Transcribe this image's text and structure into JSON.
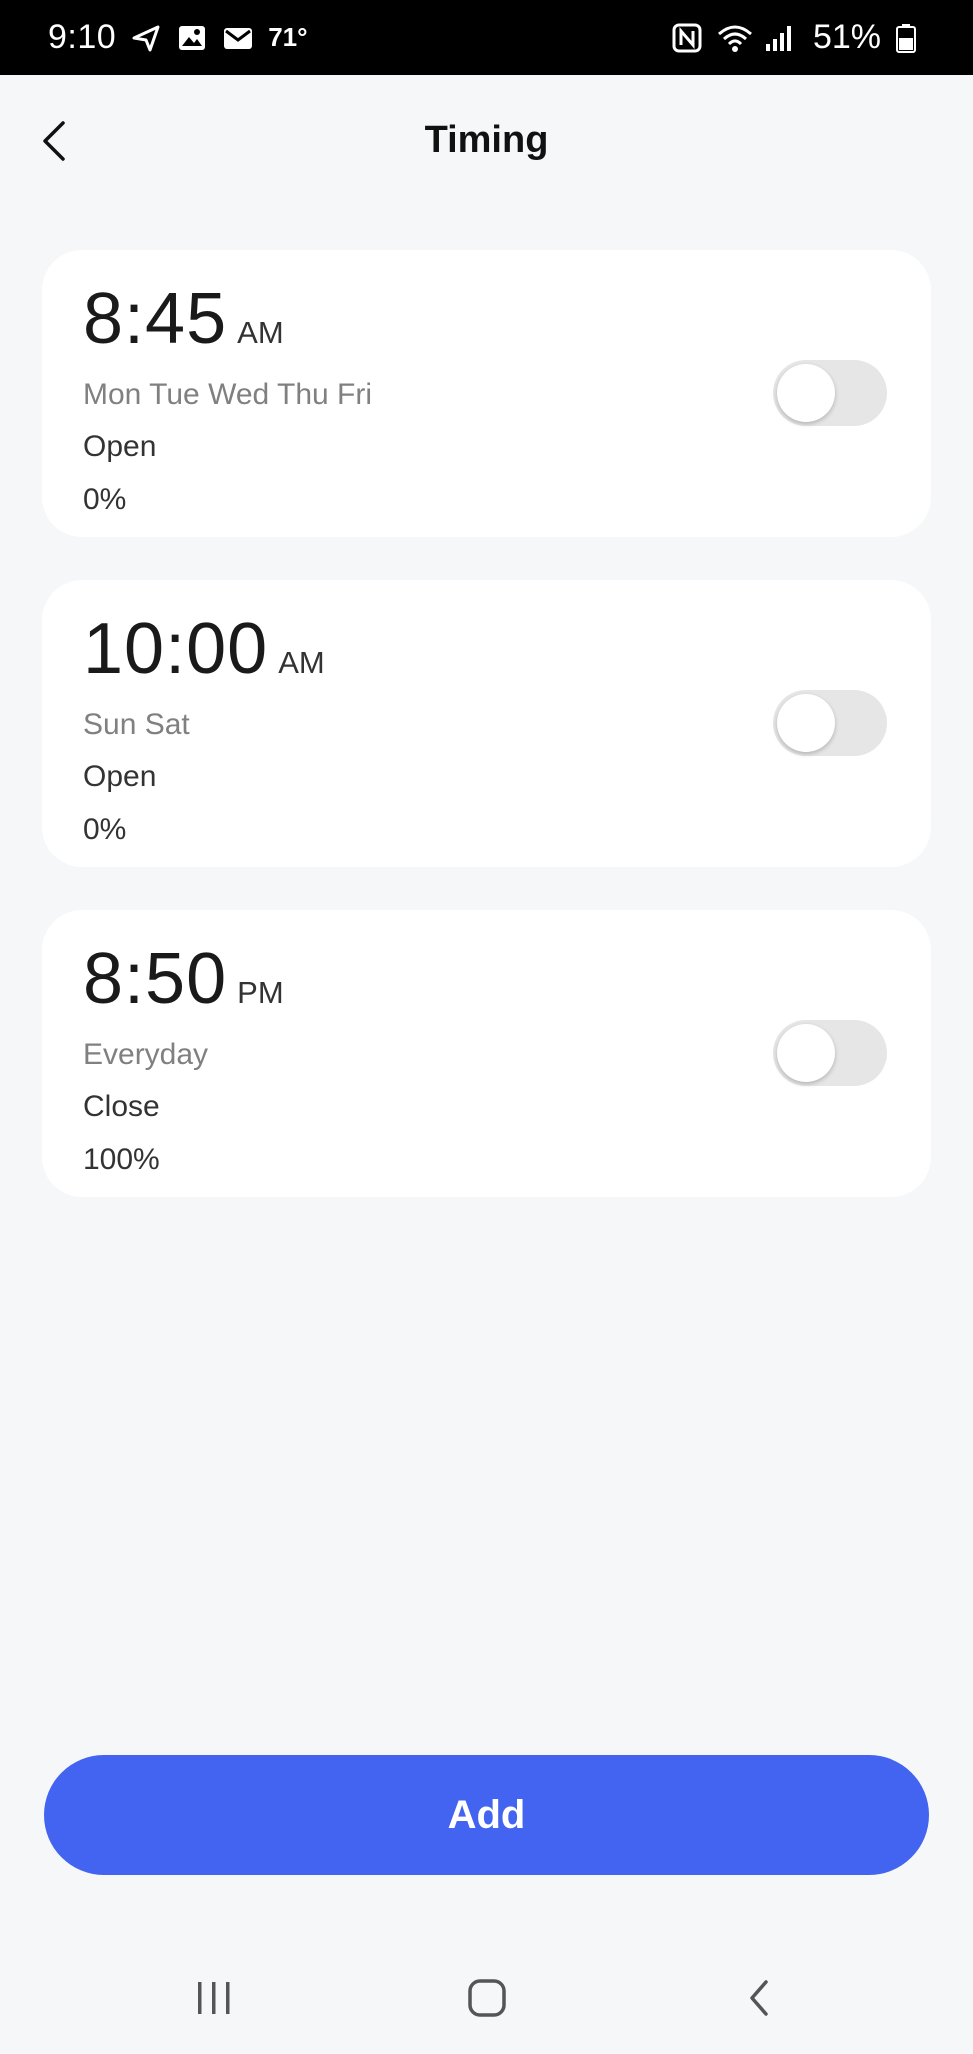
{
  "status_bar": {
    "time": "9:10",
    "temperature": "71°",
    "battery": "51%",
    "icons_left": [
      "navigation-arrow-icon",
      "image-icon",
      "mail-icon"
    ],
    "icons_right": [
      "nfc-icon",
      "wifi-icon",
      "signal-icon",
      "battery-icon"
    ]
  },
  "header": {
    "title": "Timing",
    "back_icon": "chevron-left-icon"
  },
  "timers": [
    {
      "time": "8:45",
      "period": "AM",
      "days": "Mon Tue Wed Thu Fri",
      "action": "Open",
      "percent": "0%",
      "enabled": false
    },
    {
      "time": "10:00",
      "period": "AM",
      "days": "Sun Sat",
      "action": "Open",
      "percent": "0%",
      "enabled": false
    },
    {
      "time": "8:50",
      "period": "PM",
      "days": "Everyday",
      "action": "Close",
      "percent": "100%",
      "enabled": false
    }
  ],
  "add_button": {
    "label": "Add"
  },
  "nav_bar": {
    "recents_icon": "recents-icon",
    "home_icon": "home-icon",
    "back_icon": "back-icon"
  },
  "colors": {
    "background": "#f6f7f9",
    "card": "#ffffff",
    "accent": "#4264f0",
    "toggle_off": "#e6e6e6",
    "status_bar": "#000000"
  }
}
